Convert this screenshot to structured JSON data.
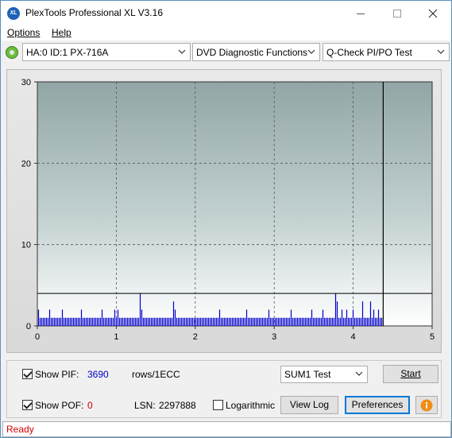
{
  "window": {
    "title": "PlexTools Professional XL V3.16",
    "logo_text": "XL"
  },
  "menu": {
    "options": "Options",
    "help": "Help"
  },
  "toolbar": {
    "drive": "HA:0 ID:1  PX-716A",
    "function": "DVD Diagnostic Functions",
    "test": "Q-Check PI/PO Test"
  },
  "chart_data": {
    "type": "bar",
    "title": "",
    "xlabel": "",
    "ylabel": "",
    "xlim": [
      0,
      5
    ],
    "ylim": [
      0,
      30
    ],
    "x_ticks": [
      "0",
      "1",
      "2",
      "3",
      "4",
      "5"
    ],
    "y_ticks": [
      "0",
      "10",
      "20",
      "30"
    ],
    "grid": true,
    "threshold_line": 4,
    "cursor_x": 4.38,
    "series": [
      {
        "color": "#0000cc",
        "x_range": [
          0,
          4.38
        ],
        "baseline_height": 1,
        "spikes": [
          {
            "x": 0.02,
            "y": 2
          },
          {
            "x": 0.15,
            "y": 2
          },
          {
            "x": 0.31,
            "y": 2
          },
          {
            "x": 0.55,
            "y": 2
          },
          {
            "x": 0.81,
            "y": 2
          },
          {
            "x": 0.98,
            "y": 2
          },
          {
            "x": 1.02,
            "y": 2
          },
          {
            "x": 1.31,
            "y": 4
          },
          {
            "x": 1.33,
            "y": 2
          },
          {
            "x": 1.72,
            "y": 3
          },
          {
            "x": 1.75,
            "y": 2
          },
          {
            "x": 2.31,
            "y": 2
          },
          {
            "x": 2.66,
            "y": 2
          },
          {
            "x": 2.93,
            "y": 2
          },
          {
            "x": 3.22,
            "y": 2
          },
          {
            "x": 3.48,
            "y": 2
          },
          {
            "x": 3.62,
            "y": 2
          },
          {
            "x": 3.77,
            "y": 4
          },
          {
            "x": 3.8,
            "y": 3
          },
          {
            "x": 3.86,
            "y": 2
          },
          {
            "x": 3.92,
            "y": 2
          },
          {
            "x": 4.0,
            "y": 2
          },
          {
            "x": 4.12,
            "y": 3
          },
          {
            "x": 4.22,
            "y": 3
          },
          {
            "x": 4.27,
            "y": 2
          },
          {
            "x": 4.33,
            "y": 2
          }
        ]
      }
    ]
  },
  "controls": {
    "show_pif_label": "Show PIF:",
    "show_pif_checked": true,
    "pif_value": "3690",
    "pif_unit": "rows/1ECC",
    "show_pof_label": "Show POF:",
    "show_pof_checked": true,
    "pof_value": "0",
    "lsn_label": "LSN:",
    "lsn_value": "2297888",
    "logarithmic_label": "Logarithmic",
    "logarithmic_checked": false,
    "mode_select": "SUM1 Test",
    "start_label": "Start",
    "view_log_label": "View Log",
    "preferences_label": "Preferences",
    "info_icon": "info-icon",
    "pif_color": "#0000cc",
    "pof_color": "#d00000"
  },
  "status": {
    "text": "Ready"
  }
}
